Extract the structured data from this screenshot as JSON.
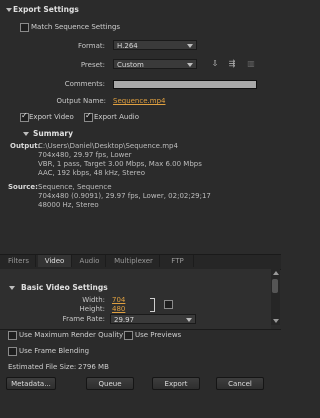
{
  "export_settings": {
    "title": "Export Settings",
    "match_sequence_label": "Match Sequence Settings",
    "match_sequence_checked": false,
    "format_label": "Format:",
    "format_value": "H.264",
    "preset_label": "Preset:",
    "preset_value": "Custom",
    "comments_label": "Comments:",
    "comments_value": "",
    "output_name_label": "Output Name:",
    "output_name_value": "Sequence.mp4",
    "export_video_label": "Export Video",
    "export_video_checked": true,
    "export_audio_label": "Export Audio",
    "export_audio_checked": true
  },
  "summary": {
    "title": "Summary",
    "output_label": "Output:",
    "output_lines": [
      "C:\\Users\\Daniel\\Desktop\\Sequence.mp4",
      "704x480, 29.97 fps, Lower",
      "VBR, 1 pass, Target 3.00 Mbps, Max 6.00 Mbps",
      "AAC, 192 kbps, 48 kHz, Stereo"
    ],
    "source_label": "Source:",
    "source_lines": [
      "Sequence, Sequence",
      "704x480 (0.9091), 29.97 fps, Lower, 02;02;29;17",
      "48000 Hz, Stereo"
    ]
  },
  "tabs": [
    "Filters",
    "Video",
    "Audio",
    "Multiplexer",
    "FTP"
  ],
  "active_tab": "Video",
  "basic_video": {
    "title": "Basic Video Settings",
    "width_label": "Width:",
    "width_value": "704",
    "height_label": "Height:",
    "height_value": "480",
    "frame_rate_label": "Frame Rate:",
    "frame_rate_value": "29.97"
  },
  "options": {
    "max_render_label": "Use Maximum Render Quality",
    "use_previews_label": "Use Previews",
    "frame_blending_label": "Use Frame Blending"
  },
  "file_size_label": "Estimated File Size:",
  "file_size_value": "2796 MB",
  "buttons": {
    "metadata": "Metadata...",
    "queue": "Queue",
    "export": "Export",
    "cancel": "Cancel"
  },
  "colors": {
    "link": "#e0a040",
    "background": "#2b2b2b"
  }
}
